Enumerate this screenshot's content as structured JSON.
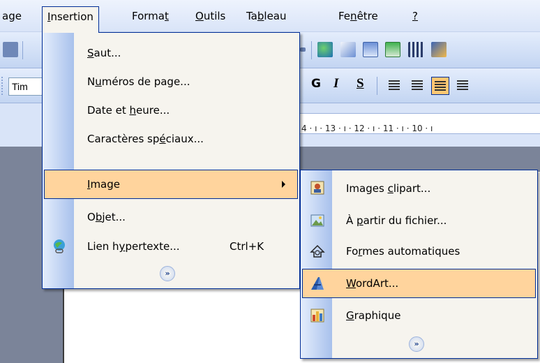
{
  "menubar": {
    "items": [
      {
        "pre": "age",
        "acc": "",
        "post": ""
      },
      {
        "pre": "",
        "acc": "I",
        "post": "nsertion"
      },
      {
        "pre": "Forma",
        "acc": "t",
        "post": ""
      },
      {
        "pre": "",
        "acc": "O",
        "post": "utils"
      },
      {
        "pre": "Ta",
        "acc": "b",
        "post": "leau"
      },
      {
        "pre": "Fe",
        "acc": "n",
        "post": "être"
      },
      {
        "pre": "",
        "acc": "?",
        "post": ""
      }
    ]
  },
  "toolbar": {
    "font_name": "Tim",
    "bold": "G",
    "italic": "I",
    "underline": "S"
  },
  "ruler": {
    "text": "4 · ı · 13 · ı · 12 · ı · 11 · ı · 10 · ı"
  },
  "insertion_menu": {
    "items": [
      {
        "pre": "",
        "acc": "S",
        "post": "aut..."
      },
      {
        "pre": "N",
        "acc": "u",
        "post": "méros de page..."
      },
      {
        "pre": "Date et ",
        "acc": "h",
        "post": "eure..."
      },
      {
        "pre": "Caractères sp",
        "acc": "é",
        "post": "ciaux..."
      },
      {
        "pre": "",
        "acc": "I",
        "post": "mage"
      },
      {
        "pre": "O",
        "acc": "b",
        "post": "jet..."
      },
      {
        "pre": "Lien h",
        "acc": "y",
        "post": "pertexte...",
        "shortcut": "Ctrl+K"
      }
    ],
    "expand_glyph": "»"
  },
  "image_submenu": {
    "items": [
      {
        "pre": "Images ",
        "acc": "c",
        "post": "lipart..."
      },
      {
        "pre": "À ",
        "acc": "p",
        "post": "artir du fichier..."
      },
      {
        "pre": "Fo",
        "acc": "r",
        "post": "mes automatiques"
      },
      {
        "pre": "",
        "acc": "W",
        "post": "ordArt..."
      },
      {
        "pre": "",
        "acc": "G",
        "post": "raphique"
      }
    ],
    "expand_glyph": "»"
  },
  "colors": {
    "highlight": "#ffd49d",
    "menu_border": "#002d96",
    "menu_bg": "#f6f4ee",
    "toolbar_bg": "#c3d5f2"
  }
}
